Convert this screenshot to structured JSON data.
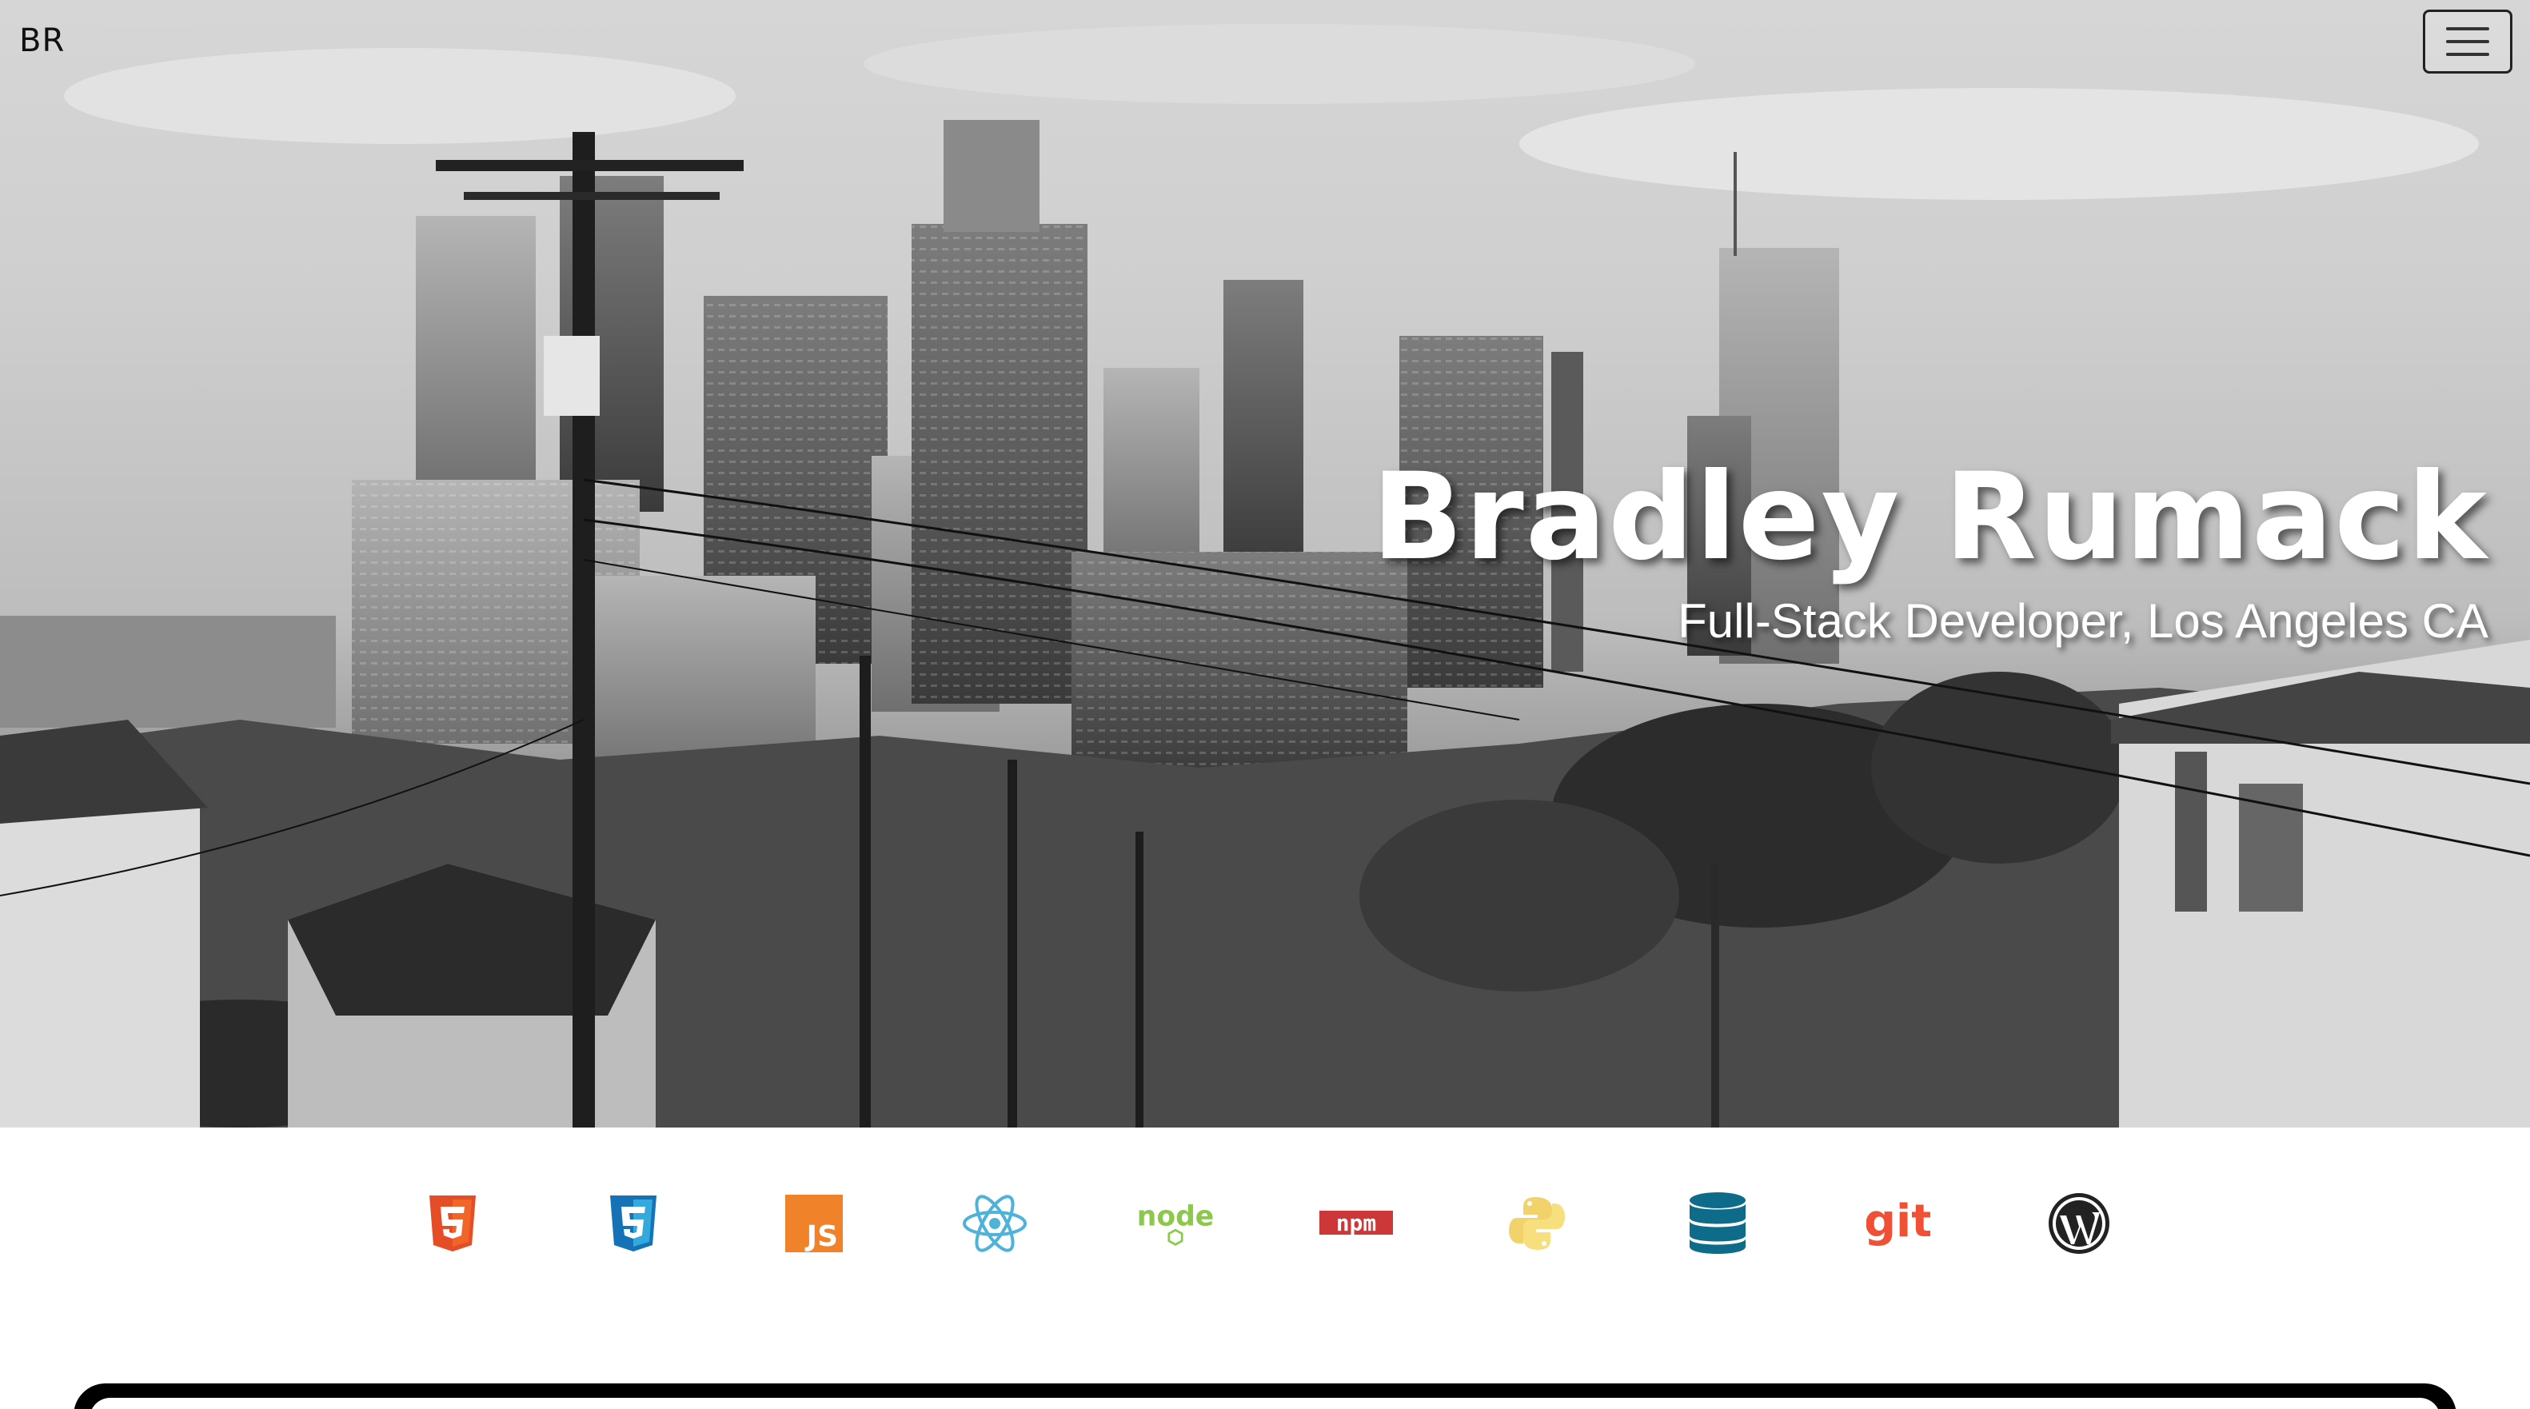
{
  "nav": {
    "brand": "BR",
    "menu_icon": "hamburger-menu-icon"
  },
  "hero": {
    "title": "Bradley Rumack",
    "subtitle": "Full-Stack Developer, Los Angeles CA",
    "background_image": "black-and-white Los Angeles skyline"
  },
  "tech_icons": [
    {
      "name": "html5-icon",
      "color": "#e44d26"
    },
    {
      "name": "css3-icon",
      "color": "#1572b6"
    },
    {
      "name": "javascript-icon",
      "color": "#f0822a",
      "text": "JS"
    },
    {
      "name": "react-icon",
      "color": "#61dafb"
    },
    {
      "name": "nodejs-icon",
      "color": "#8cc84b",
      "text": "node"
    },
    {
      "name": "npm-icon",
      "color": "#cb3837",
      "text": "npm"
    },
    {
      "name": "python-icon",
      "color": "#ffd43b"
    },
    {
      "name": "database-icon",
      "color": "#0e6b8a"
    },
    {
      "name": "git-icon",
      "color": "#f05033",
      "text": "git"
    },
    {
      "name": "wordpress-icon",
      "color": "#222222"
    }
  ]
}
